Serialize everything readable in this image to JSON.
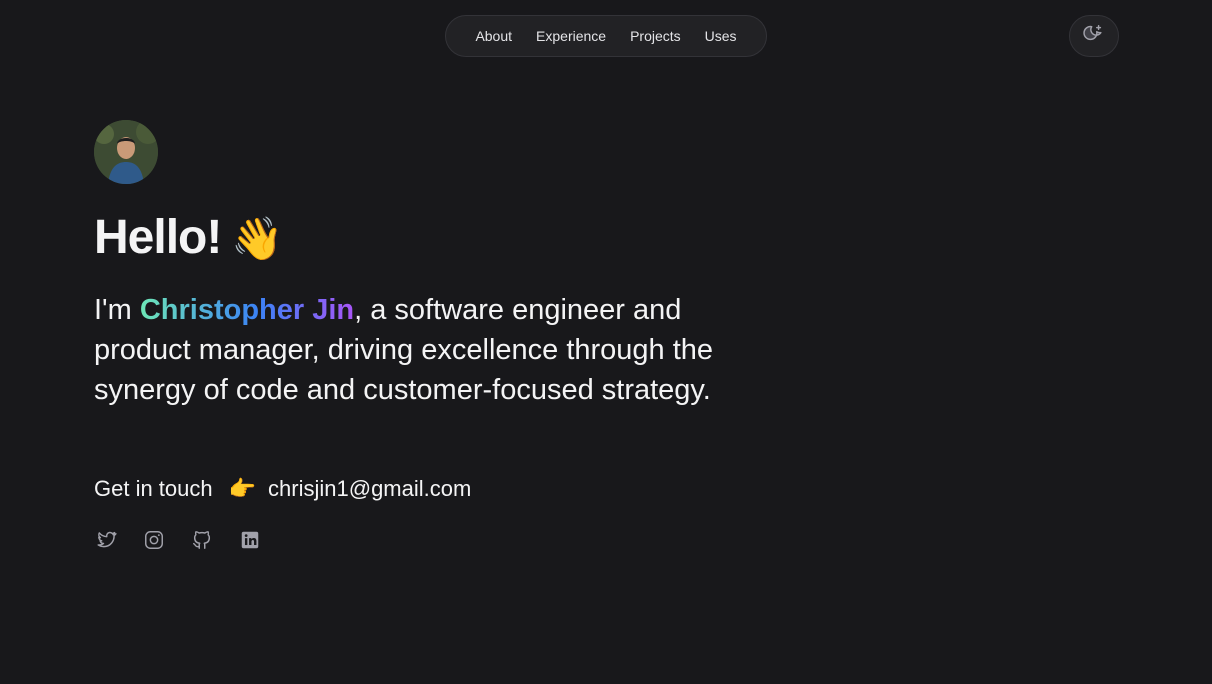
{
  "nav": {
    "items": [
      {
        "label": "About"
      },
      {
        "label": "Experience"
      },
      {
        "label": "Projects"
      },
      {
        "label": "Uses"
      }
    ]
  },
  "theme_toggle": {
    "icon": "moon-sparkle-icon"
  },
  "profile": {
    "avatar_icon": "profile-photo"
  },
  "hero": {
    "greeting": "Hello!",
    "wave": "👋",
    "intro_prefix": "I'm ",
    "name": "Christopher Jin",
    "intro_suffix": ", a software engineer and product manager, driving excellence through the synergy of code and customer-focused strategy."
  },
  "contact": {
    "label": "Get in touch",
    "pointer": "👉",
    "email": "chrisjin1@gmail.com"
  },
  "socials": [
    {
      "icon": "twitter-icon"
    },
    {
      "icon": "instagram-icon"
    },
    {
      "icon": "github-icon"
    },
    {
      "icon": "linkedin-icon"
    }
  ],
  "colors": {
    "background": "#18181b",
    "text": "#f4f4f5",
    "gradient_start": "#6ee7b7",
    "gradient_mid": "#3b82f6",
    "gradient_end": "#a855f7"
  }
}
